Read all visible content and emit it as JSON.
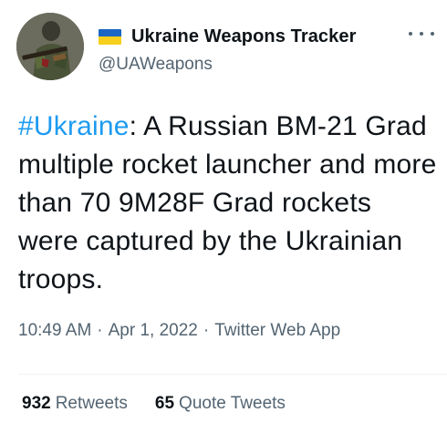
{
  "author": {
    "display_name": "Ukraine Weapons Tracker",
    "handle": "@UAWeapons",
    "avatar_icon": "soldier-with-rifle-avatar",
    "flag_colors": [
      "#1a66c4",
      "#f7cf1d"
    ]
  },
  "more_icon": "more-horizontal-icon",
  "tweet": {
    "hashtag": "#Ukraine",
    "text": ": A Russian BM-21 Grad multiple rocket launcher and more than 70 9M28F Grad rockets were captured by the Ukrainian troops."
  },
  "meta": {
    "time": "10:49 AM",
    "separator": "·",
    "date": "Apr 1, 2022",
    "source": "Twitter Web App"
  },
  "stats": {
    "retweets_count": "932",
    "retweets_label": "Retweets",
    "quotes_count": "65",
    "quotes_label": "Quote Tweets"
  },
  "colors": {
    "link": "#1d9bf0",
    "secondary_text": "#536471",
    "primary_text": "#0f1419"
  }
}
